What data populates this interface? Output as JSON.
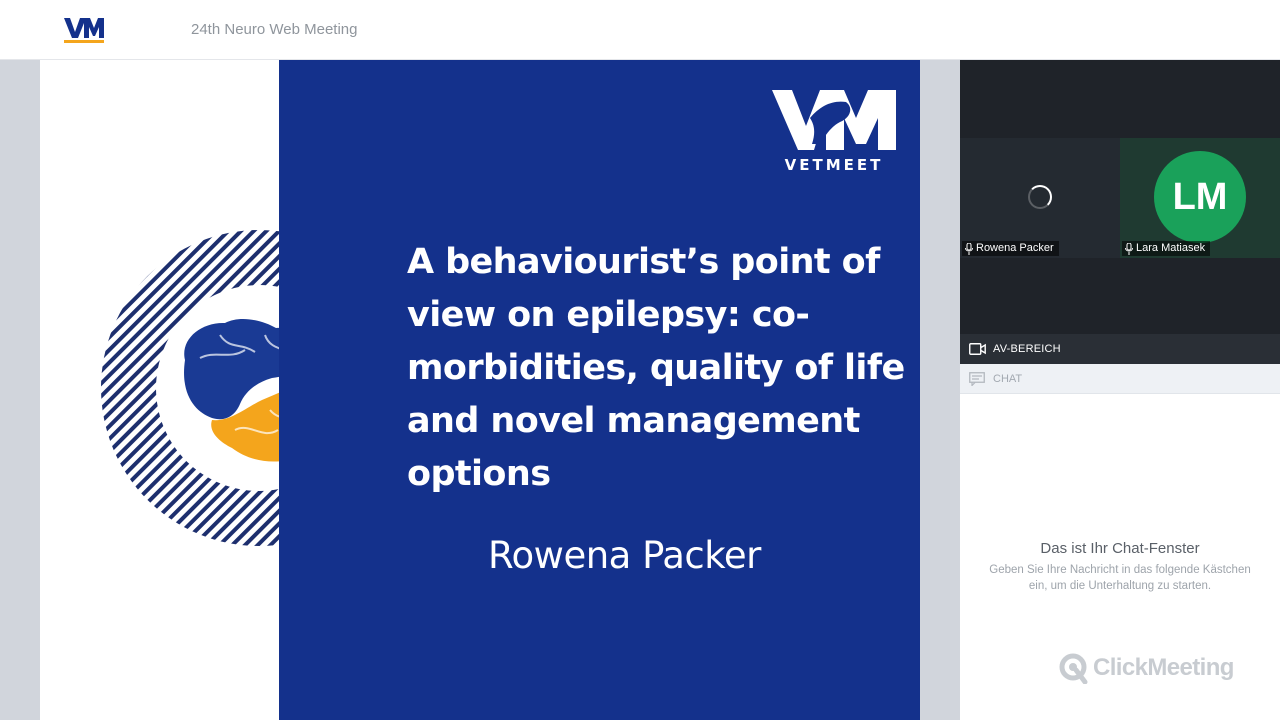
{
  "header": {
    "logo": "vetmeet-logo-icon",
    "meeting_title": "24th Neuro Web Meeting"
  },
  "slide": {
    "logo_text": "VETMEET",
    "title": "A behaviourist’s point of view on epilepsy: co-morbidities, quality of life and novel management options",
    "author": "Rowena Packer",
    "colors": {
      "blue": "#14318c",
      "orange": "#f4a51c",
      "navy": "#1d2f6e"
    }
  },
  "av": {
    "participants": [
      {
        "name": "Rowena Packer",
        "state": "loading",
        "mic_icon": "microphone-icon"
      },
      {
        "name": "Lara Matiasek",
        "initials": "LM",
        "avatar_color": "#1aa15a",
        "mic_icon": "microphone-icon"
      }
    ],
    "section_label": "AV-BEREICH",
    "section_icon": "camera-icon"
  },
  "chat": {
    "section_label": "CHAT",
    "section_icon": "chat-icon",
    "title": "Das ist Ihr Chat-Fenster",
    "description": "Geben Sie Ihre Nachricht in das folgende Kästchen ein, um die Unterhaltung zu starten.",
    "brand": "ClickMeeting"
  }
}
